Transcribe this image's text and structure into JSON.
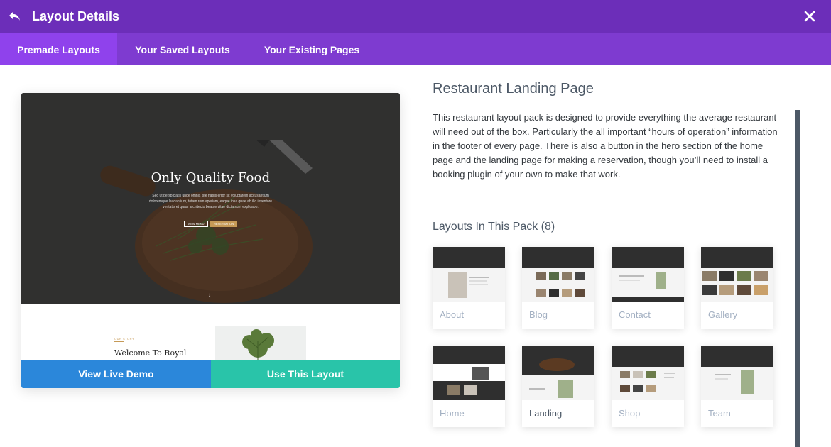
{
  "header": {
    "title": "Layout Details",
    "back_icon": "undo-arrow-icon",
    "close_icon": "close-x-icon",
    "bg_color": "#6c2eb9"
  },
  "tabs": [
    {
      "label": "Premade Layouts",
      "active": true
    },
    {
      "label": "Your Saved Layouts",
      "active": false
    },
    {
      "label": "Your Existing Pages",
      "active": false
    }
  ],
  "preview": {
    "hero_title": "Only Quality Food",
    "hero_text": "Sed ut perspiciatis unde omnis iste natus error sit voluptatem accusantium doloremque laudantium, totam rem aperiam, eaque ipsa quae ab illo inventore veritatis et quasi architecto beatae vitae dicta sunt explicabo.",
    "hero_btn1": "VIEW MENU",
    "hero_btn2": "RESERVATION",
    "section_kicker": "OUR STORY",
    "section_title": "Welcome To Royal",
    "view_demo_label": "View Live Demo",
    "use_layout_label": "Use This Layout",
    "colors": {
      "demo": "#2b87da",
      "use": "#29c4a9"
    }
  },
  "details": {
    "title": "Restaurant Landing Page",
    "description": "This restaurant layout pack is designed to provide everything the average restaurant will need out of the box. Particularly the all important “hours of operation” information in the footer of every page. There is also a button in the hero section of the home page and the landing page for making a reservation, though you’ll need to install a booking plugin of your own to make that work.",
    "pack_title": "Layouts In This Pack (8)"
  },
  "layouts": [
    {
      "label": "About"
    },
    {
      "label": "Blog"
    },
    {
      "label": "Contact"
    },
    {
      "label": "Gallery"
    },
    {
      "label": "Home"
    },
    {
      "label": "Landing"
    },
    {
      "label": "Shop"
    },
    {
      "label": "Team"
    }
  ]
}
